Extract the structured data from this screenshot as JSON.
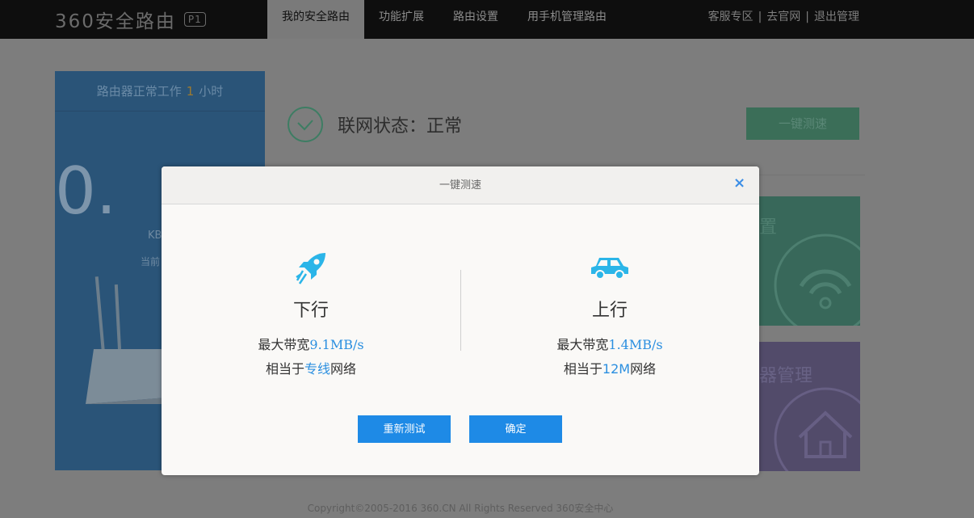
{
  "header": {
    "logo_text": "360安全路由",
    "logo_badge": "P1",
    "tabs": [
      {
        "label": "我的安全路由",
        "active": true
      },
      {
        "label": "功能扩展",
        "active": false
      },
      {
        "label": "路由设置",
        "active": false
      },
      {
        "label": "用手机管理路由",
        "active": false
      }
    ],
    "links": [
      "客服专区",
      "去官网",
      "退出管理"
    ],
    "link_separator": "|"
  },
  "left_panel": {
    "uptime_prefix": "路由器正常工作",
    "uptime_value": "1",
    "uptime_unit": "小时",
    "speed_value": "0.",
    "speed_unit": "KB",
    "current_label": "当前"
  },
  "status": {
    "label": "联网状态：正常",
    "speedtest_button": "一键测速"
  },
  "tiles": {
    "green_title": "置",
    "purple_title": "器管理"
  },
  "modal": {
    "title": "一键测速",
    "close_icon": "×",
    "download": {
      "label": "下行",
      "bandwidth_prefix": "最大带宽",
      "bandwidth_value": "9.1MB/s",
      "equiv_prefix": "相当于",
      "equiv_value": "专线",
      "equiv_suffix": "网络",
      "icon": "rocket-icon"
    },
    "upload": {
      "label": "上行",
      "bandwidth_prefix": "最大带宽",
      "bandwidth_value": "1.4MB/s",
      "equiv_prefix": "相当于",
      "equiv_value": "12M",
      "equiv_suffix": "网络",
      "icon": "car-icon"
    },
    "retest_button": "重新测试",
    "ok_button": "确定"
  },
  "footer": {
    "copyright": "Copyright©2005-2016 360.CN All Rights Reserved 360安全中心"
  },
  "colors": {
    "accent_blue": "#1e8ae6",
    "highlight_blue": "#2b8fe0",
    "icon_cyan": "#2bb5e8"
  }
}
